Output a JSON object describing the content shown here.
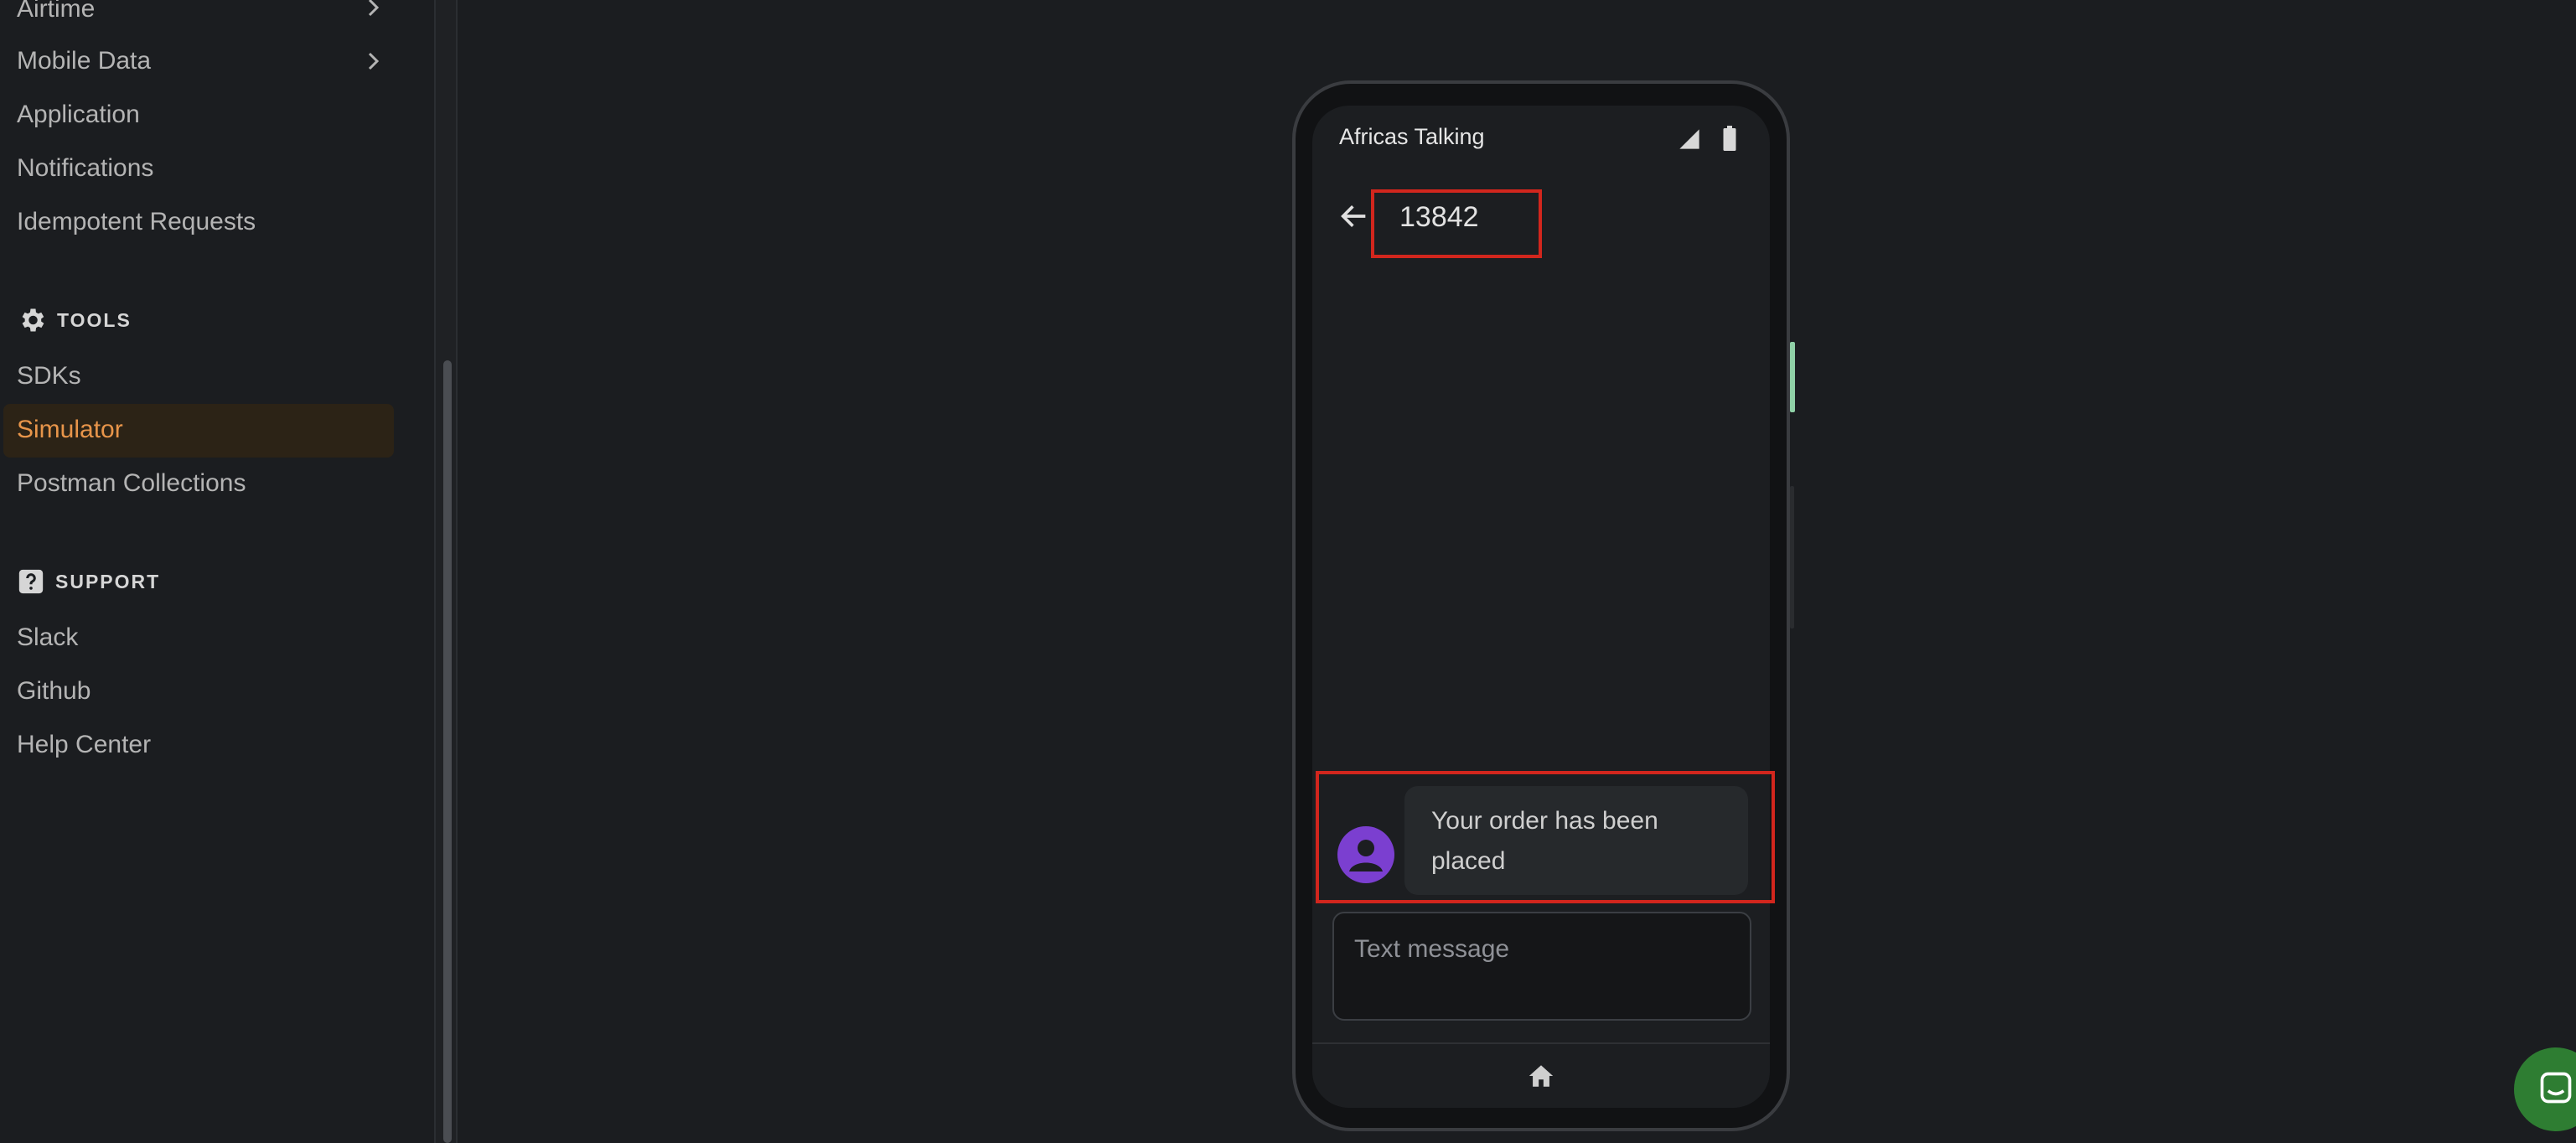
{
  "sidebar": {
    "items_top": [
      {
        "label": "Airtime",
        "has_chevron": true
      },
      {
        "label": "Mobile Data",
        "has_chevron": true
      },
      {
        "label": "Application",
        "has_chevron": false
      },
      {
        "label": "Notifications",
        "has_chevron": false
      },
      {
        "label": "Idempotent Requests",
        "has_chevron": false
      }
    ],
    "tools_heading": "TOOLS",
    "tools_items": [
      "SDKs",
      "Simulator",
      "Postman Collections"
    ],
    "active_item": "Simulator",
    "support_heading": "SUPPORT",
    "support_items": [
      "Slack",
      "Github",
      "Help Center"
    ]
  },
  "phone": {
    "app_title": "Africas Talking",
    "conversation_number": "13842",
    "message": "Your order has been placed",
    "input_placeholder": "Text message"
  },
  "colors": {
    "background": "#1b1d20",
    "active_text": "#e8954a",
    "active_bg": "#2c2316",
    "highlight_box": "#d2261d",
    "avatar": "#7b3fd0",
    "chat_launcher": "#2e7d32"
  },
  "icons": [
    "chevron-right-icon",
    "gear-icon",
    "question-icon",
    "signal-icon",
    "battery-icon",
    "back-arrow-icon",
    "user-avatar-icon",
    "home-icon",
    "chat-icon"
  ]
}
